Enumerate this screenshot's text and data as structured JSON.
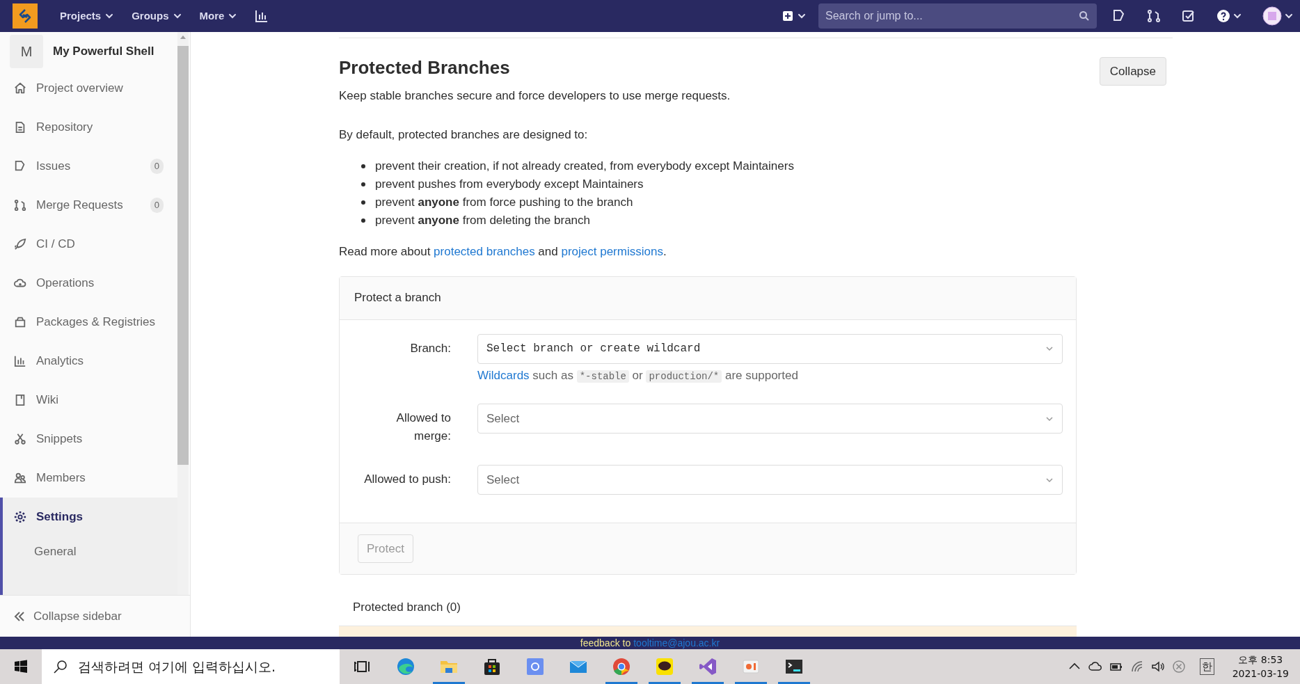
{
  "topbar": {
    "nav": [
      {
        "label": "Projects"
      },
      {
        "label": "Groups"
      },
      {
        "label": "More"
      }
    ],
    "search": {
      "placeholder": "Search or jump to..."
    }
  },
  "sidebar": {
    "project": {
      "avatar": "M",
      "name": "My Powerful Shell"
    },
    "items": [
      {
        "label": "Project overview",
        "selected": false
      },
      {
        "label": "Repository",
        "selected": false
      },
      {
        "label": "Issues",
        "count": "0",
        "selected": false
      },
      {
        "label": "Merge Requests",
        "count": "0",
        "selected": false
      },
      {
        "label": "CI / CD",
        "selected": false
      },
      {
        "label": "Operations",
        "selected": false
      },
      {
        "label": "Packages & Registries",
        "selected": false
      },
      {
        "label": "Analytics",
        "selected": false
      },
      {
        "label": "Wiki",
        "selected": false
      },
      {
        "label": "Snippets",
        "selected": false
      },
      {
        "label": "Members",
        "selected": false
      },
      {
        "label": "Settings",
        "selected": true,
        "children": [
          {
            "label": "General",
            "selected": false
          }
        ]
      }
    ],
    "collapse": "Collapse sidebar"
  },
  "section": {
    "title": "Protected Branches",
    "collapse_button": "Collapse",
    "intro": "Keep stable branches secure and force developers to use merge requests.",
    "lead": "By default, protected branches are designed to:",
    "bullets": [
      "prevent their creation, if not already created, from everybody except Maintainers",
      "prevent pushes from everybody except Maintainers",
      "prevent **anyone** from force pushing to the branch",
      "prevent **anyone** from deleting the branch"
    ],
    "read_more": [
      {
        "kind": "text",
        "text": "Read more about "
      },
      {
        "kind": "link",
        "text": "protected branches"
      },
      {
        "kind": "text",
        "text": " and "
      },
      {
        "kind": "link",
        "text": "project permissions"
      },
      {
        "kind": "text",
        "text": "."
      }
    ]
  },
  "form": {
    "title": "Protect a branch",
    "fields": [
      {
        "label": "Branch:",
        "kind": "branch",
        "placeholder": "Select branch or create wildcard",
        "hint": [
          {
            "kind": "link",
            "text": "Wildcards"
          },
          {
            "kind": "text",
            "text": " such as "
          },
          {
            "kind": "code",
            "text": "*-stable"
          },
          {
            "kind": "text",
            "text": " or "
          },
          {
            "kind": "code",
            "text": "production/*"
          },
          {
            "kind": "text",
            "text": " are supported"
          }
        ]
      },
      {
        "label": "Allowed to merge:",
        "kind": "select",
        "placeholder": "Select"
      },
      {
        "label": "Allowed to push:",
        "kind": "select",
        "placeholder": "Select"
      }
    ],
    "button": {
      "label": "Protect",
      "disabled": true
    }
  },
  "protected_list": {
    "title": "Protected branch (0)"
  },
  "feedback": {
    "text": "feedback to",
    "email": "tooltime@ajou.ac.kr"
  },
  "taskbar": {
    "search": {
      "placeholder": "검색하려면 여기에 입력하십시오."
    },
    "apps": [
      {
        "running": false
      },
      {
        "running": true
      },
      {
        "running": false
      },
      {
        "running": false
      },
      {
        "running": false
      },
      {
        "running": true
      },
      {
        "running": true
      },
      {
        "running": true
      },
      {
        "running": true
      },
      {
        "running": true
      }
    ],
    "tray": {
      "ime": "한",
      "time": "오후 8:53",
      "date": "2021-03-19"
    }
  }
}
